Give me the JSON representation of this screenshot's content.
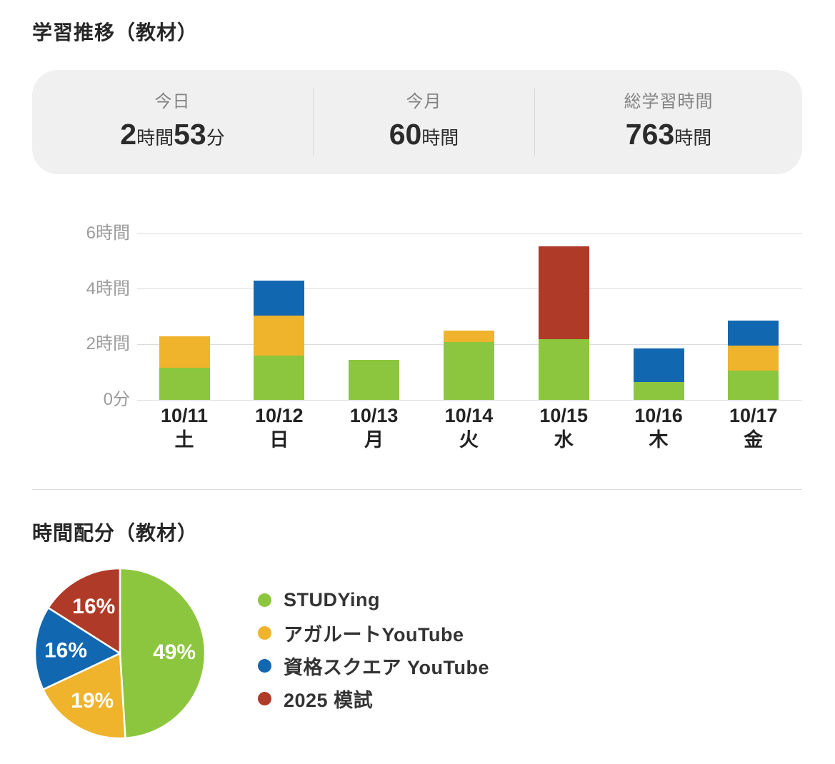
{
  "header": {
    "title": "学習推移（教材）"
  },
  "stats": {
    "items": [
      {
        "label": "今日",
        "big1": "2",
        "small1": "時間",
        "big2": "53",
        "small2": "分"
      },
      {
        "label": "今月",
        "big1": "60",
        "small1": "時間",
        "big2": "",
        "small2": ""
      },
      {
        "label": "総学習時間",
        "big1": "763",
        "small1": "時間",
        "big2": "",
        "small2": ""
      }
    ]
  },
  "pie_section": {
    "title": "時間配分（教材）"
  },
  "legend": {
    "items": [
      {
        "label": "STUDYing",
        "color": "#8cc63e"
      },
      {
        "label": "アガルートYouTube",
        "color": "#f0b32c"
      },
      {
        "label": "資格スクエア YouTube",
        "color": "#1267b1"
      },
      {
        "label": "2025 模試",
        "color": "#b03a28"
      }
    ]
  },
  "colors": {
    "green": "#8cc63e",
    "yellow": "#f0b32c",
    "blue": "#1267b1",
    "red": "#b03a28",
    "gridline": "#dcdcdc",
    "card_bg": "#f0f0f1"
  },
  "chart_data": [
    {
      "type": "bar",
      "stacked": true,
      "title": "学習推移（教材）",
      "unit": "hours",
      "categories": [
        "10/11",
        "10/12",
        "10/13",
        "10/14",
        "10/15",
        "10/16",
        "10/17"
      ],
      "weekdays": [
        "土",
        "日",
        "月",
        "火",
        "水",
        "木",
        "金"
      ],
      "series": [
        {
          "name": "STUDYing",
          "color": "#8cc63e",
          "values": [
            1.15,
            1.6,
            1.45,
            2.1,
            2.2,
            0.65,
            1.05
          ]
        },
        {
          "name": "アガルートYouTube",
          "color": "#f0b32c",
          "values": [
            1.15,
            1.45,
            0,
            0.4,
            0,
            0,
            0.9
          ]
        },
        {
          "name": "資格スクエア YouTube",
          "color": "#1267b1",
          "values": [
            0,
            1.25,
            0,
            0,
            0,
            1.2,
            0.9
          ]
        },
        {
          "name": "2025 模試",
          "color": "#b03a28",
          "values": [
            0,
            0,
            0,
            0,
            3.35,
            0,
            0
          ]
        }
      ],
      "totals": [
        2.3,
        4.3,
        1.45,
        2.5,
        5.55,
        1.85,
        2.85
      ],
      "yticks": [
        {
          "value": 0,
          "label": "0分"
        },
        {
          "value": 2,
          "label": "2時間"
        },
        {
          "value": 4,
          "label": "4時間"
        },
        {
          "value": 6,
          "label": "6時間"
        }
      ],
      "ylim": [
        0,
        6.4
      ],
      "grid": true,
      "legend_position": "none"
    },
    {
      "type": "pie",
      "title": "時間配分（教材）",
      "start_angle_deg_from_north": 0,
      "direction": "clockwise",
      "slices": [
        {
          "name": "STUDYing",
          "pct": 49,
          "label": "49%",
          "color": "#8cc63e"
        },
        {
          "name": "アガルートYouTube",
          "pct": 19,
          "label": "19%",
          "color": "#f0b32c"
        },
        {
          "name": "資格スクエア YouTube",
          "pct": 16,
          "label": "16%",
          "color": "#1267b1"
        },
        {
          "name": "2025 模試",
          "pct": 16,
          "label": "16%",
          "color": "#b03a28"
        }
      ],
      "legend_position": "right"
    }
  ]
}
